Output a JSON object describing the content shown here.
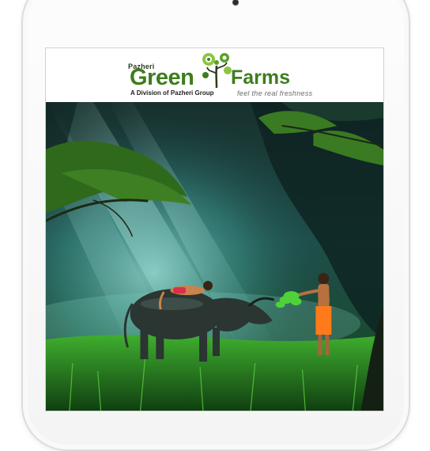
{
  "app": {
    "brand_prefix": "Pazheri",
    "brand_word1": "Green",
    "brand_word2": "Farms",
    "division": "A Division of Pazheri Group",
    "tagline": "feel the real freshness"
  },
  "colors": {
    "brand_green": "#3e7d1e",
    "logo_leaf_light": "#8cc63f",
    "logo_leaf_dark": "#3e7d1e",
    "tagline_gray": "#6b6b6b"
  },
  "icons": {
    "logo_mark": "tree-sprout-icon",
    "camera": "front-camera"
  },
  "hero": {
    "scene": "forest-light-rays-buffalo-children"
  }
}
